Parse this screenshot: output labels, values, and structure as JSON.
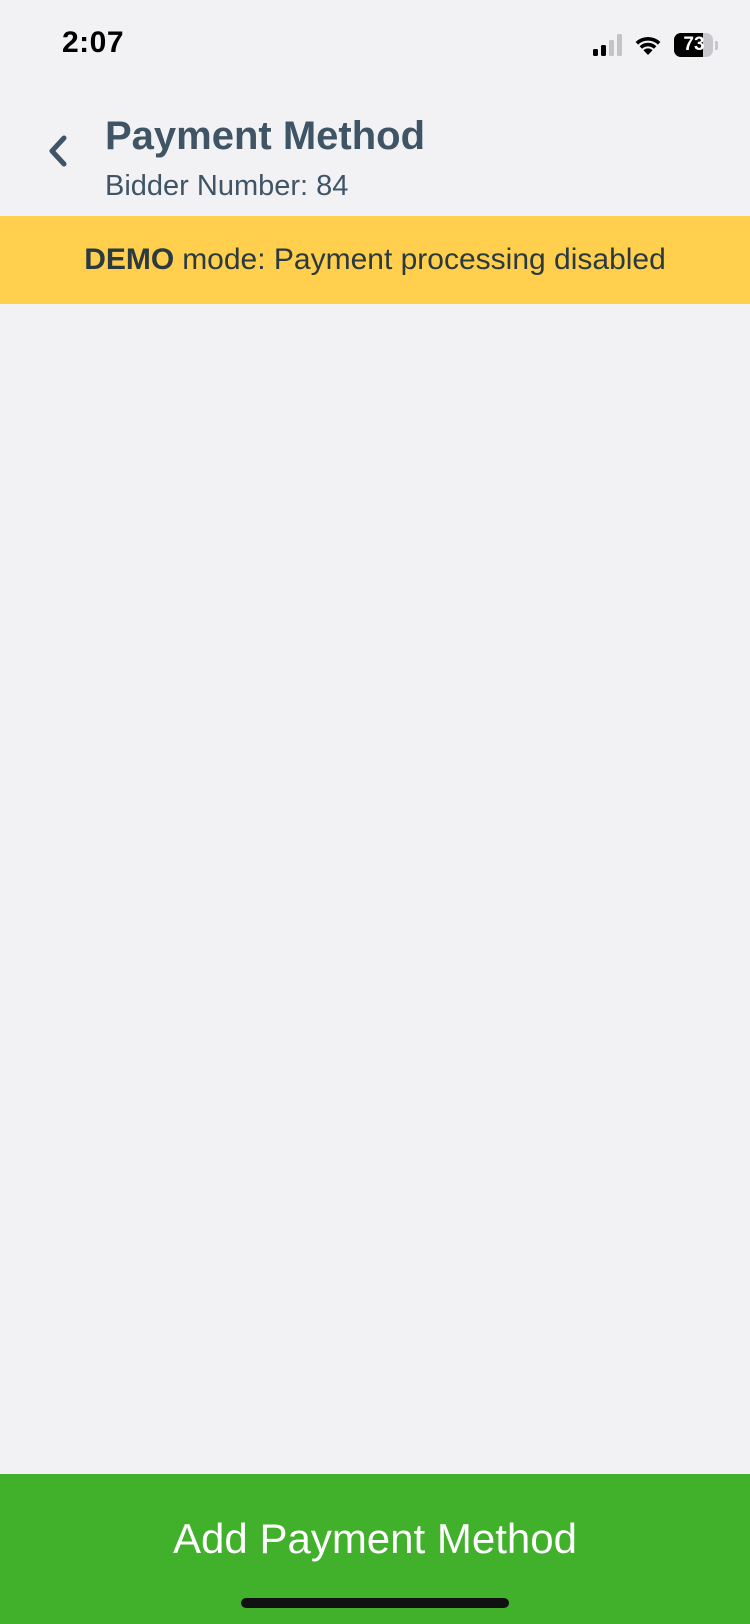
{
  "status_bar": {
    "time": "2:07",
    "battery_percent": "73",
    "battery_level": 0.73,
    "icons": [
      "cellular-signal-icon",
      "wifi-icon",
      "battery-icon"
    ]
  },
  "header": {
    "back_icon": "chevron-left-icon",
    "title": "Payment Method",
    "subtitle": "Bidder Number: 84"
  },
  "banner": {
    "strong_text": "DEMO",
    "text": "mode: Payment processing disabled"
  },
  "footer": {
    "button_label": "Add Payment Method"
  },
  "colors": {
    "background": "#f2f2f5",
    "header_text": "#3f5566",
    "banner": "#ffcf4d",
    "button": "#41b02a",
    "button_text": "#ffffff"
  }
}
